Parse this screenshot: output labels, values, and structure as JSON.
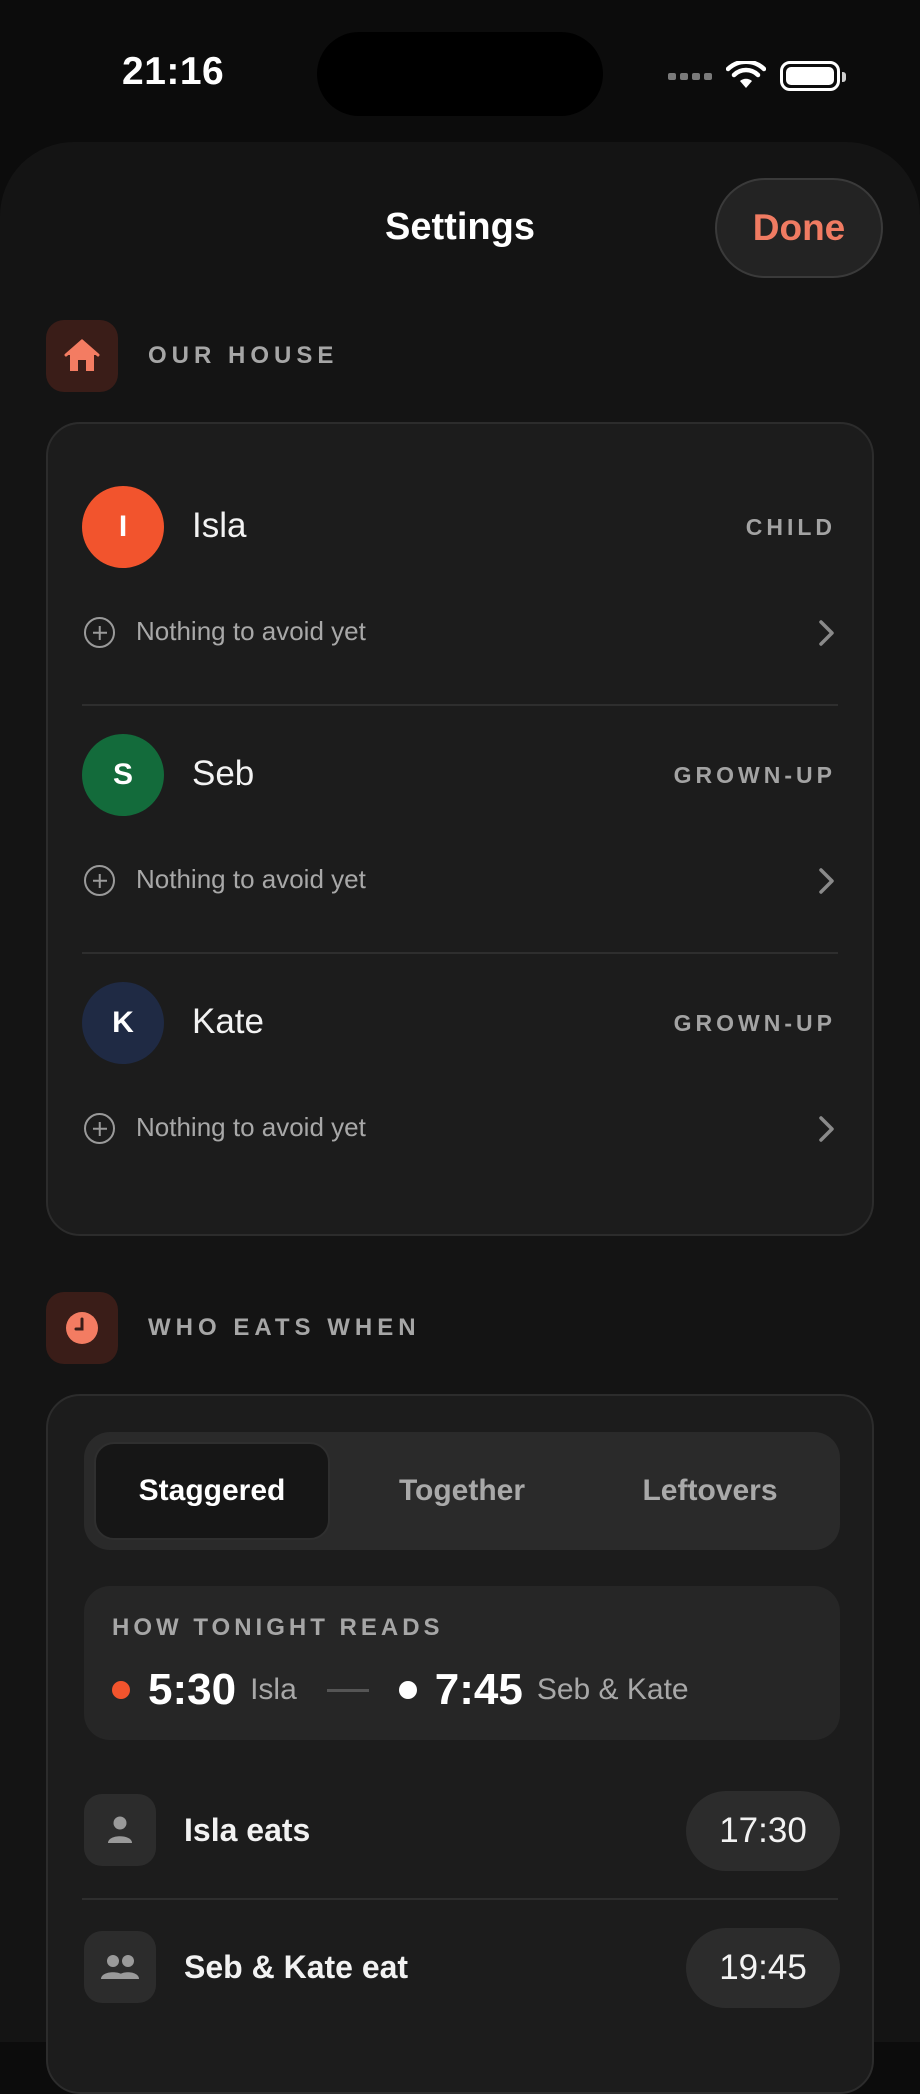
{
  "status_bar": {
    "time": "21:16"
  },
  "nav": {
    "title": "Settings",
    "done_label": "Done"
  },
  "our_house": {
    "label": "OUR HOUSE",
    "members": [
      {
        "initial": "I",
        "name": "Isla",
        "role": "CHILD",
        "avoid": "Nothing to avoid yet",
        "color": "#f2542d"
      },
      {
        "initial": "S",
        "name": "Seb",
        "role": "GROWN-UP",
        "avoid": "Nothing to avoid yet",
        "color": "#136b3b"
      },
      {
        "initial": "K",
        "name": "Kate",
        "role": "GROWN-UP",
        "avoid": "Nothing to avoid yet",
        "color": "#1f2a44"
      }
    ]
  },
  "who_eats_when": {
    "label": "WHO EATS WHEN",
    "segments": [
      "Staggered",
      "Together",
      "Leftovers"
    ],
    "selected_segment": "Staggered",
    "summary": {
      "label": "HOW TONIGHT READS",
      "first_time": "5:30",
      "first_who": "Isla",
      "second_time": "7:45",
      "second_who": "Seb & Kate"
    },
    "rows": [
      {
        "label": "Isla eats",
        "time": "17:30",
        "icon": "person-icon"
      },
      {
        "label": "Seb & Kate eat",
        "time": "19:45",
        "icon": "people-icon"
      }
    ]
  },
  "colors": {
    "accent": "#f07b62",
    "child_dot": "#f2542d",
    "grownup_dot": "#ffffff",
    "card_bg": "#1c1c1c"
  }
}
